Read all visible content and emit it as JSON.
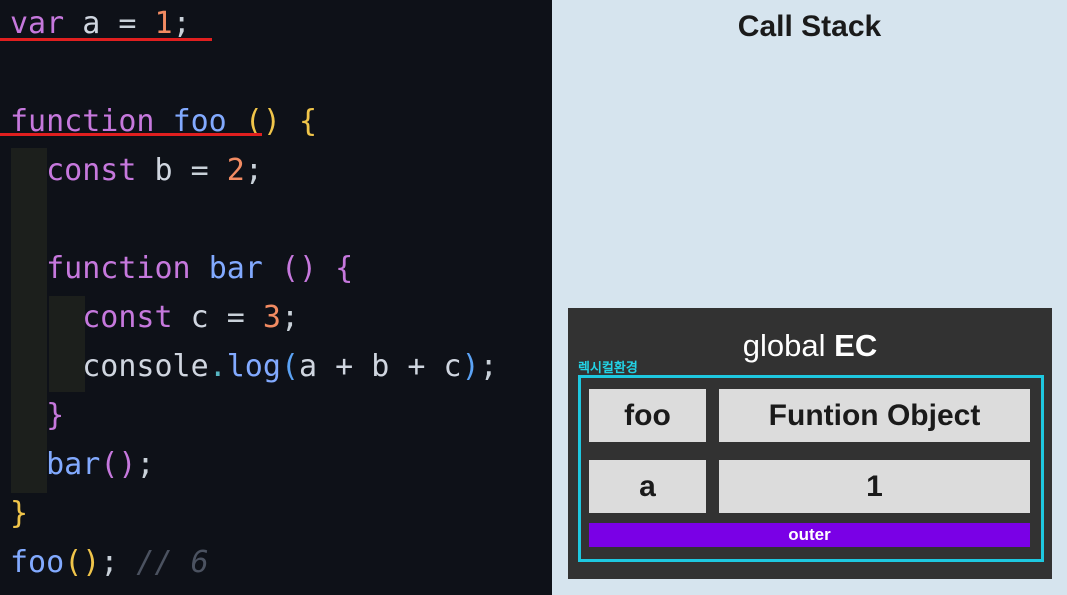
{
  "code": {
    "lines": [
      [
        {
          "t": "var",
          "c": "kw"
        },
        {
          "t": " ",
          "c": "op"
        },
        {
          "t": "a",
          "c": "id"
        },
        {
          "t": " = ",
          "c": "op"
        },
        {
          "t": "1",
          "c": "num"
        },
        {
          "t": ";",
          "c": "punc"
        }
      ],
      [],
      [
        {
          "t": "function",
          "c": "kw"
        },
        {
          "t": " ",
          "c": "op"
        },
        {
          "t": "foo",
          "c": "fn"
        },
        {
          "t": " ",
          "c": "op"
        },
        {
          "t": "()",
          "c": "br1"
        },
        {
          "t": " ",
          "c": "op"
        },
        {
          "t": "{",
          "c": "br1"
        }
      ],
      [
        {
          "t": "  const",
          "c": "kw"
        },
        {
          "t": " ",
          "c": "op"
        },
        {
          "t": "b",
          "c": "id"
        },
        {
          "t": " = ",
          "c": "op"
        },
        {
          "t": "2",
          "c": "num"
        },
        {
          "t": ";",
          "c": "punc"
        }
      ],
      [],
      [
        {
          "t": "  function",
          "c": "kw"
        },
        {
          "t": " ",
          "c": "op"
        },
        {
          "t": "bar",
          "c": "fn"
        },
        {
          "t": " ",
          "c": "op"
        },
        {
          "t": "()",
          "c": "br2"
        },
        {
          "t": " ",
          "c": "op"
        },
        {
          "t": "{",
          "c": "br2"
        }
      ],
      [
        {
          "t": "    const",
          "c": "kw"
        },
        {
          "t": " ",
          "c": "op"
        },
        {
          "t": "c",
          "c": "id"
        },
        {
          "t": " = ",
          "c": "op"
        },
        {
          "t": "3",
          "c": "num"
        },
        {
          "t": ";",
          "c": "punc"
        }
      ],
      [
        {
          "t": "    console",
          "c": "id"
        },
        {
          "t": ".",
          "c": "dot"
        },
        {
          "t": "log",
          "c": "fn"
        },
        {
          "t": "(",
          "c": "br3"
        },
        {
          "t": "a + b + c",
          "c": "id"
        },
        {
          "t": ")",
          "c": "br3"
        },
        {
          "t": ";",
          "c": "punc"
        }
      ],
      [
        {
          "t": "  }",
          "c": "br2"
        }
      ],
      [
        {
          "t": "  bar",
          "c": "fn"
        },
        {
          "t": "()",
          "c": "br2"
        },
        {
          "t": ";",
          "c": "punc"
        }
      ],
      [
        {
          "t": "}",
          "c": "br1"
        }
      ],
      [
        {
          "t": "foo",
          "c": "fn"
        },
        {
          "t": "()",
          "c": "br1"
        },
        {
          "t": ";",
          "c": "punc"
        },
        {
          "t": " // 6",
          "c": "cmt"
        }
      ]
    ]
  },
  "call_stack": {
    "title": "Call Stack",
    "ec": {
      "title_prefix": "global ",
      "title_strong": "EC",
      "lexical_env_label": "렉시컬환경",
      "records": [
        {
          "name": "foo",
          "value": "Funtion Object"
        },
        {
          "name": "a",
          "value": "1"
        }
      ],
      "outer_label": "outer"
    }
  },
  "colors": {
    "editor_bg": "#0e1118",
    "stack_bg": "#d6e4ee",
    "ec_bg": "#323232",
    "lex_border": "#1ec8e0",
    "outer_bar": "#7a00e6",
    "underline": "#e01f1f"
  }
}
